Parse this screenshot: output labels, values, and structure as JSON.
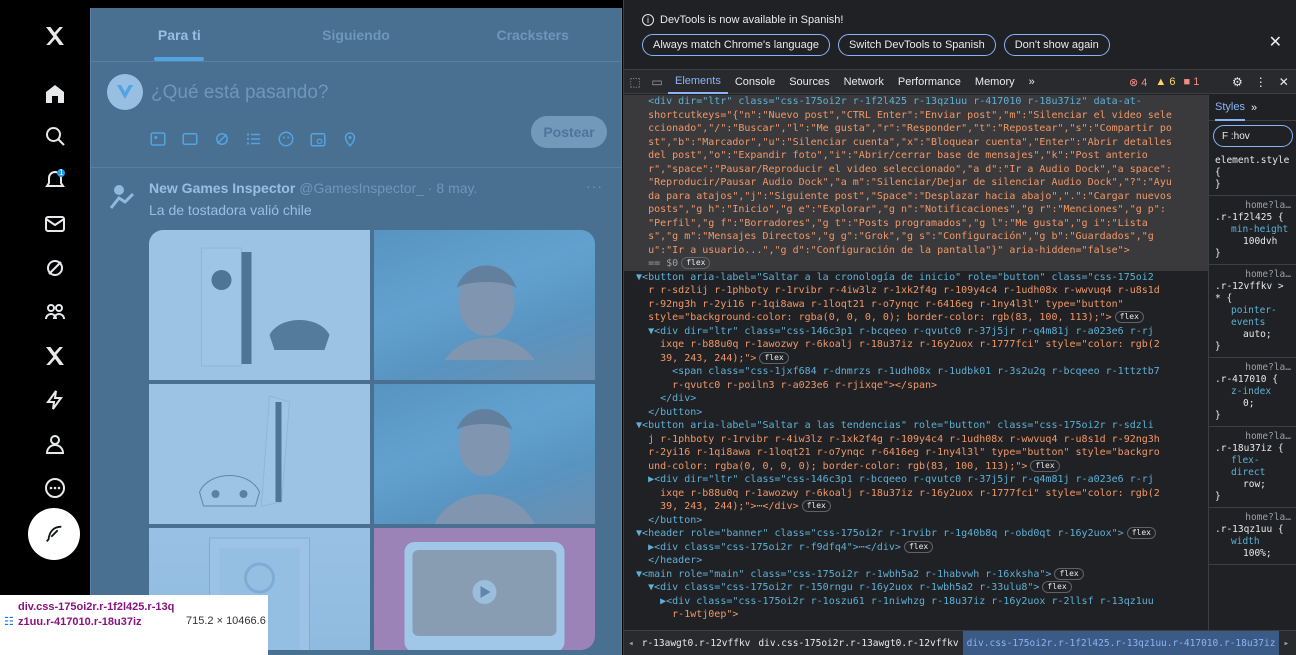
{
  "x": {
    "tabs": [
      {
        "label": "Para ti",
        "active": true
      },
      {
        "label": "Siguiendo",
        "active": false
      },
      {
        "label": "Cracksters",
        "active": false
      }
    ],
    "composer": {
      "placeholder": "¿Qué está pasando?",
      "post_label": "Postear"
    },
    "notifications_badge": "1",
    "tweet": {
      "author": "New Games Inspector",
      "handle": "@GamesInspector_ · 8 may.",
      "text": "La de tostadora valió chile",
      "more": "···"
    }
  },
  "inspect_tooltip": {
    "selector": "div.css-175oi2r.r-1f2l425.r-13qz1uu.r-417010.r-18u37iz",
    "dims": "715.2 × 10466.6"
  },
  "devtools": {
    "banner": {
      "message": "DevTools is now available in Spanish!",
      "actions": [
        "Always match Chrome's language",
        "Switch DevTools to Spanish",
        "Don't show again"
      ]
    },
    "tabs": [
      "Elements",
      "Console",
      "Sources",
      "Network",
      "Performance",
      "Memory",
      "»"
    ],
    "counts": {
      "errors": "4",
      "warnings": "6",
      "issues": "1"
    },
    "styles": {
      "tab_label": "Styles",
      "filter_label": "F :hov",
      "rules": [
        {
          "src": "",
          "selector": "element.style {",
          "props": [],
          "close": "}"
        },
        {
          "src": "home?la…",
          "selector": ".r-1f2l425 {",
          "props": [
            {
              "name": "min-height",
              "value": "100dvh"
            }
          ],
          "close": "}"
        },
        {
          "src": "home?la…",
          "selector": ".r-12vffkv > * {",
          "props": [
            {
              "name": "pointer-events",
              "value": "auto;"
            }
          ],
          "close": "}"
        },
        {
          "src": "home?la…",
          "selector": ".r-417010 {",
          "props": [
            {
              "name": "z-index",
              "value": "0;"
            }
          ],
          "close": "}"
        },
        {
          "src": "home?la…",
          "selector": ".r-18u37iz {",
          "props": [
            {
              "name": "flex-direct",
              "value": "row;"
            }
          ],
          "close": "}"
        },
        {
          "src": "home?la…",
          "selector": ".r-13qz1uu {",
          "props": [
            {
              "name": "width",
              "value": "100%;"
            }
          ],
          "close": ""
        }
      ]
    },
    "breadcrumbs": [
      "r-13awgt0.r-12vffkv",
      "div.css-175oi2r.r-13awgt0.r-12vffkv",
      "div.css-175oi2r.r-1f2l425.r-13qz1uu.r-417010.r-18u37iz"
    ],
    "dom_lines": [
      "    <div dir=\"ltr\" class=\"css-175oi2r r-1f2l425 r-13qz1uu r-417010 r-18u37iz\" data-at-",
      "    shortcutkeys=\"{\"n\":\"Nuevo post\",\"CTRL Enter\":\"Enviar post\",\"m\":\"Silenciar el video sele",
      "    ccionado\",\"/\":\"Buscar\",\"l\":\"Me gusta\",\"r\":\"Responder\",\"t\":\"Repostear\",\"s\":\"Compartir po",
      "    st\",\"b\":\"Marcador\",\"u\":\"Silenciar cuenta\",\"x\":\"Bloquear cuenta\",\"Enter\":\"Abrir detalles",
      "    del post\",\"o\":\"Expandir foto\",\"i\":\"Abrir/cerrar base de mensajes\",\"k\":\"Post anterio",
      "    r\",\"space\":\"Pausar/Reproducir el video seleccionado\",\"a d\":\"Ir a Audio Dock\",\"a space\":",
      "    \"Reproducir/Pausar Audio Dock\",\"a m\":\"Silenciar/Dejar de silenciar Audio Dock\",\"?\":\"Ayu",
      "    da para atajos\",\"j\":\"Siguiente post\",\"Space\":\"Desplazar hacia abajo\",\".\":\"Cargar nuevos",
      "    posts\",\"g h\":\"Inicio\",\"g e\":\"Explorar\",\"g n\":\"Notificaciones\",\"g r\":\"Menciones\",\"g p\":",
      "    \"Perfil\",\"g f\":\"Borradores\",\"g t\":\"Posts programados\",\"g l\":\"Me gusta\",\"g i\":\"Lista",
      "    s\",\"g m\":\"Mensajes Directos\",\"g g\":\"Grok\",\"g s\":\"Configuración\",\"g b\":\"Guardados\",\"g",
      "    u\":\"Ir a usuario...\",\"g d\":\"Configuración de la pantalla\"}\" aria-hidden=\"false\">",
      "    == $0",
      "  ▼<button aria-label=\"Saltar a la cronología de inicio\" role=\"button\" class=\"css-175oi2",
      "    r r-sdzlij r-1phboty r-1rvibr r-4iw3lz r-1xk2f4g r-109y4c4 r-1udh08x r-wwvuq4 r-u8s1d",
      "    r-92ng3h r-2yi16 r-1qi8awa r-1loqt21 r-o7ynqc r-6416eg r-1ny4l3l\" type=\"button\"",
      "    style=\"background-color: rgba(0, 0, 0, 0); border-color: rgb(83, 100, 113);\">",
      "    ▼<div dir=\"ltr\" class=\"css-146c3p1 r-bcqeeo r-qvutc0 r-37j5jr r-q4m81j r-a023e6 r-rj",
      "      ixqe r-b88u0q r-1awozwy r-6koalj r-18u37iz r-16y2uox r-1777fci\" style=\"color: rgb(2",
      "      39, 243, 244);\">",
      "        <span class=\"css-1jxf684 r-dnmrzs r-1udh08x r-1udbk01 r-3s2u2q r-bcqeeo r-1ttztb7",
      "        r-qvutc0 r-poiln3 r-a023e6 r-rjixqe\"></span>",
      "      </div>",
      "    </button>",
      "  ▼<button aria-label=\"Saltar a las tendencias\" role=\"button\" class=\"css-175oi2r r-sdzli",
      "    j r-1phboty r-1rvibr r-4iw3lz r-1xk2f4g r-109y4c4 r-1udh08x r-wwvuq4 r-u8s1d r-92ng3h",
      "    r-2yi16 r-1qi8awa r-1loqt21 r-o7ynqc r-6416eg r-1ny4l3l\" type=\"button\" style=\"backgro",
      "    und-color: rgba(0, 0, 0, 0); border-color: rgb(83, 100, 113);\">",
      "    ▶<div dir=\"ltr\" class=\"css-146c3p1 r-bcqeeo r-qvutc0 r-37j5jr r-q4m81j r-a023e6 r-rj",
      "      ixqe r-b88u0q r-1awozwy r-6koalj r-18u37iz r-16y2uox r-1777fci\" style=\"color: rgb(2",
      "      39, 243, 244);\">⋯</div>",
      "    </button>",
      "  ▼<header role=\"banner\" class=\"css-175oi2r r-1rvibr r-1g40b8q r-obd0qt r-16y2uox\">",
      "    ▶<div class=\"css-175oi2r r-f9dfq4\">⋯</div>",
      "    </header>",
      "  ▼<main role=\"main\" class=\"css-175oi2r r-1wbh5a2 r-1habvwh r-16xksha\">",
      "    ▼<div class=\"css-175oi2r r-150rngu r-16y2uox r-1wbh5a2 r-33ulu8\">",
      "      ▶<div class=\"css-175oi2r r-1oszu61 r-1niwhzg r-18u37iz r-16y2uox r-2llsf r-13qz1uu",
      "        r-1wtj0ep\">"
    ],
    "dom_badges": {
      "12": "flex",
      "16": "flex",
      "19": "flex",
      "27": "flex",
      "30": "flex",
      "32": "flex",
      "33": "flex",
      "35": "flex",
      "36": "flex"
    }
  },
  "colors": {
    "accent": "#1d9bf0",
    "inspect": "#6fa8dc",
    "devtools_bg": "#202124"
  }
}
